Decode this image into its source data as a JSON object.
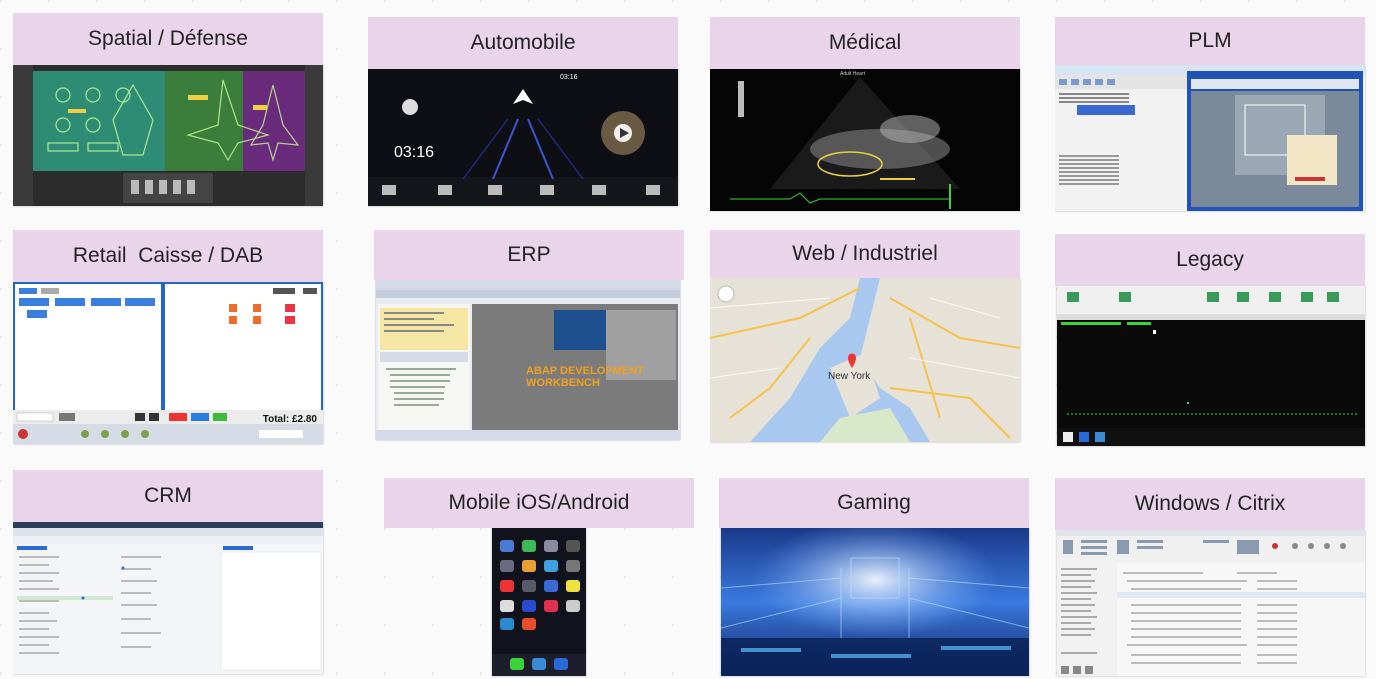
{
  "tiles": [
    {
      "key": "spatial",
      "label": "Spatial / Défense",
      "icon": "cockpit-display-icon"
    },
    {
      "key": "auto",
      "label": "Automobile",
      "icon": "car-dashboard-icon",
      "clock": "03:16",
      "status_time": "03:16"
    },
    {
      "key": "medical",
      "label": "Médical",
      "icon": "ultrasound-icon",
      "header": "Adult Heart"
    },
    {
      "key": "plm",
      "label": "PLM",
      "icon": "cad-window-icon"
    },
    {
      "key": "retail",
      "label": "Retail  Caisse / DAB",
      "icon": "pos-terminal-icon",
      "total": "Total: £2.80"
    },
    {
      "key": "erp",
      "label": "ERP",
      "icon": "sap-window-icon",
      "banner_line1": "ABAP DEVELOPMENT",
      "banner_line2": "WORKBENCH"
    },
    {
      "key": "web",
      "label": "Web / Industriel",
      "icon": "map-icon",
      "city": "New York"
    },
    {
      "key": "legacy",
      "label": "Legacy",
      "icon": "terminal-icon"
    },
    {
      "key": "crm",
      "label": "CRM",
      "icon": "crm-form-icon"
    },
    {
      "key": "mobile",
      "label": "Mobile iOS/Android",
      "icon": "smartphone-icon"
    },
    {
      "key": "gaming",
      "label": "Gaming",
      "icon": "game-scene-icon"
    },
    {
      "key": "windows",
      "label": "Windows / Citrix",
      "icon": "outlook-window-icon"
    }
  ],
  "colors": {
    "label_bg": "#ead4ea",
    "map_water": "#a9c8f0",
    "map_land": "#e6e2d8",
    "map_road": "#f5c24a",
    "terminal_bg": "#0a0a0a",
    "terminal_text": "#3cd23c",
    "erp_banner": "#f0a020",
    "gaming_blue": "#2a6fd6"
  }
}
